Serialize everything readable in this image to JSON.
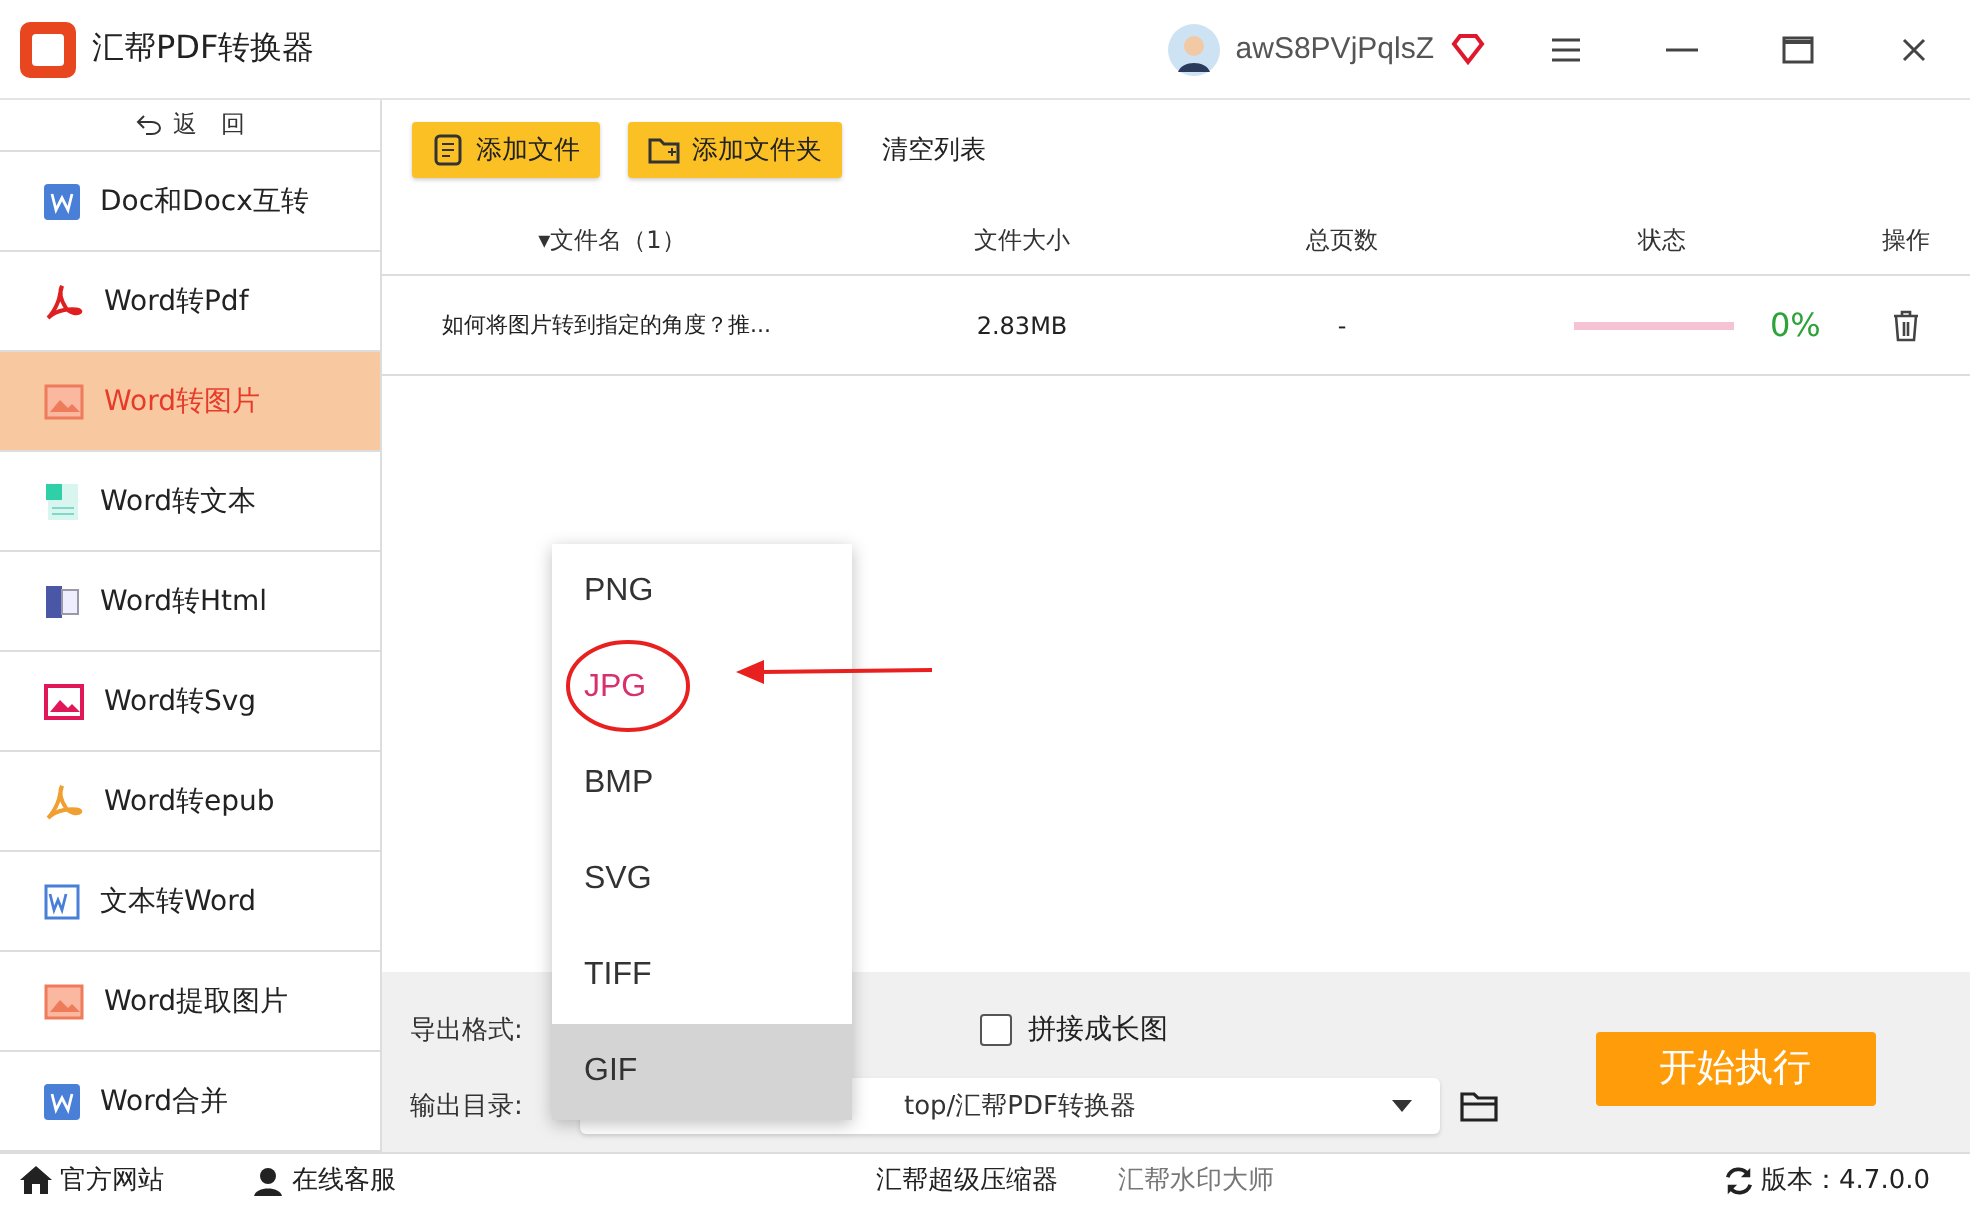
{
  "window": {
    "title": "汇帮PDF转换器",
    "user": "awS8PVjPqlsZ"
  },
  "sidebar": {
    "back": "返　回",
    "items": [
      {
        "label": "Doc和Docx互转",
        "kind": "word",
        "selected": false
      },
      {
        "label": "Word转Pdf",
        "kind": "pdf",
        "selected": false
      },
      {
        "label": "Word转图片",
        "kind": "image",
        "selected": true
      },
      {
        "label": "Word转文本",
        "kind": "text",
        "selected": false
      },
      {
        "label": "Word转Html",
        "kind": "html",
        "selected": false
      },
      {
        "label": "Word转Svg",
        "kind": "svg",
        "selected": false
      },
      {
        "label": "Word转epub",
        "kind": "epub",
        "selected": false
      },
      {
        "label": "文本转Word",
        "kind": "wordbox",
        "selected": false
      },
      {
        "label": "Word提取图片",
        "kind": "image",
        "selected": false
      },
      {
        "label": "Word合并",
        "kind": "word",
        "selected": false
      }
    ]
  },
  "toolbar": {
    "add_file": "添加文件",
    "add_folder": "添加文件夹",
    "clear": "清空列表"
  },
  "table": {
    "columns": [
      "▾文件名（1）",
      "文件大小",
      "总页数",
      "状态",
      "操作"
    ],
    "rows": [
      {
        "name": "如何将图片转到指定的角度？推...",
        "size": "2.83MB",
        "pages": "-",
        "level": 0,
        "percent": "0%"
      }
    ]
  },
  "options": {
    "format_label": "导出格式:",
    "long_image": {
      "label": "拼接成长图",
      "checked": false
    },
    "output_label": "输出目录:",
    "output_path": "top/汇帮PDF转换器",
    "start": "开始执行"
  },
  "format_menu": [
    {
      "label": "PNG",
      "selected": false,
      "circled": false
    },
    {
      "label": "JPG",
      "selected": false,
      "circled": true
    },
    {
      "label": "BMP",
      "selected": false,
      "circled": false
    },
    {
      "label": "SVG",
      "selected": false,
      "circled": false
    },
    {
      "label": "TIFF",
      "selected": false,
      "circled": false
    },
    {
      "label": "GIF",
      "selected": true,
      "circled": false
    }
  ],
  "status_bar": {
    "website": "官方网站",
    "service": "在线客服",
    "links": [
      "汇帮超级压缩器",
      "汇帮水印大师"
    ],
    "version": "版本：4.7.0.0"
  }
}
